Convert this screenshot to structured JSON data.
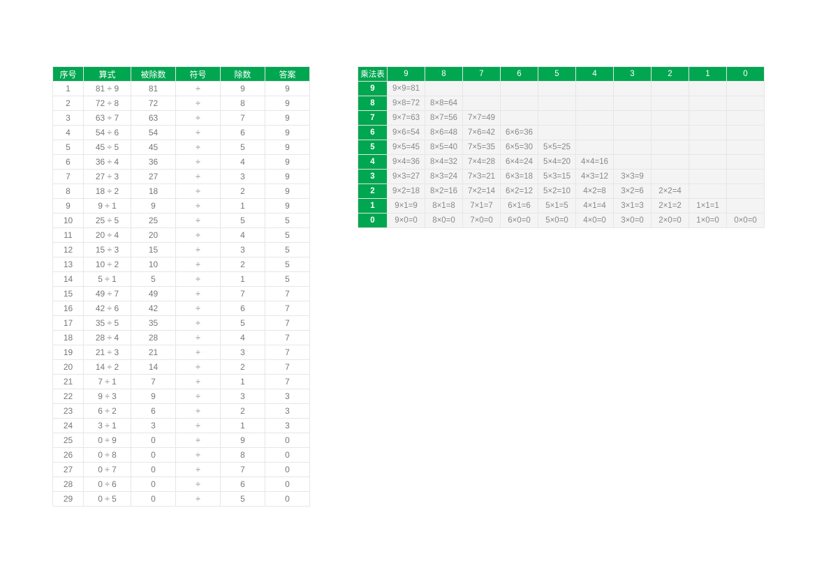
{
  "divTable": {
    "headers": [
      "序号",
      "算式",
      "被除数",
      "符号",
      "除数",
      "答案"
    ],
    "rows": [
      {
        "idx": "1",
        "expr": "81 ÷ 9",
        "dividend": "81",
        "sym": "÷",
        "divisor": "9",
        "ans": "9"
      },
      {
        "idx": "2",
        "expr": "72 ÷ 8",
        "dividend": "72",
        "sym": "÷",
        "divisor": "8",
        "ans": "9"
      },
      {
        "idx": "3",
        "expr": "63 ÷ 7",
        "dividend": "63",
        "sym": "÷",
        "divisor": "7",
        "ans": "9"
      },
      {
        "idx": "4",
        "expr": "54 ÷ 6",
        "dividend": "54",
        "sym": "÷",
        "divisor": "6",
        "ans": "9"
      },
      {
        "idx": "5",
        "expr": "45 ÷ 5",
        "dividend": "45",
        "sym": "÷",
        "divisor": "5",
        "ans": "9"
      },
      {
        "idx": "6",
        "expr": "36 ÷ 4",
        "dividend": "36",
        "sym": "÷",
        "divisor": "4",
        "ans": "9"
      },
      {
        "idx": "7",
        "expr": "27 ÷ 3",
        "dividend": "27",
        "sym": "÷",
        "divisor": "3",
        "ans": "9"
      },
      {
        "idx": "8",
        "expr": "18 ÷ 2",
        "dividend": "18",
        "sym": "÷",
        "divisor": "2",
        "ans": "9"
      },
      {
        "idx": "9",
        "expr": "9 ÷ 1",
        "dividend": "9",
        "sym": "÷",
        "divisor": "1",
        "ans": "9"
      },
      {
        "idx": "10",
        "expr": "25 ÷ 5",
        "dividend": "25",
        "sym": "÷",
        "divisor": "5",
        "ans": "5"
      },
      {
        "idx": "11",
        "expr": "20 ÷ 4",
        "dividend": "20",
        "sym": "÷",
        "divisor": "4",
        "ans": "5"
      },
      {
        "idx": "12",
        "expr": "15 ÷ 3",
        "dividend": "15",
        "sym": "÷",
        "divisor": "3",
        "ans": "5"
      },
      {
        "idx": "13",
        "expr": "10 ÷ 2",
        "dividend": "10",
        "sym": "÷",
        "divisor": "2",
        "ans": "5"
      },
      {
        "idx": "14",
        "expr": "5 ÷ 1",
        "dividend": "5",
        "sym": "÷",
        "divisor": "1",
        "ans": "5"
      },
      {
        "idx": "15",
        "expr": "49 ÷ 7",
        "dividend": "49",
        "sym": "÷",
        "divisor": "7",
        "ans": "7"
      },
      {
        "idx": "16",
        "expr": "42 ÷ 6",
        "dividend": "42",
        "sym": "÷",
        "divisor": "6",
        "ans": "7"
      },
      {
        "idx": "17",
        "expr": "35 ÷ 5",
        "dividend": "35",
        "sym": "÷",
        "divisor": "5",
        "ans": "7"
      },
      {
        "idx": "18",
        "expr": "28 ÷ 4",
        "dividend": "28",
        "sym": "÷",
        "divisor": "4",
        "ans": "7"
      },
      {
        "idx": "19",
        "expr": "21 ÷ 3",
        "dividend": "21",
        "sym": "÷",
        "divisor": "3",
        "ans": "7"
      },
      {
        "idx": "20",
        "expr": "14 ÷ 2",
        "dividend": "14",
        "sym": "÷",
        "divisor": "2",
        "ans": "7"
      },
      {
        "idx": "21",
        "expr": "7 ÷ 1",
        "dividend": "7",
        "sym": "÷",
        "divisor": "1",
        "ans": "7"
      },
      {
        "idx": "22",
        "expr": "9 ÷ 3",
        "dividend": "9",
        "sym": "÷",
        "divisor": "3",
        "ans": "3"
      },
      {
        "idx": "23",
        "expr": "6 ÷ 2",
        "dividend": "6",
        "sym": "÷",
        "divisor": "2",
        "ans": "3"
      },
      {
        "idx": "24",
        "expr": "3 ÷ 1",
        "dividend": "3",
        "sym": "÷",
        "divisor": "1",
        "ans": "3"
      },
      {
        "idx": "25",
        "expr": "0 ÷ 9",
        "dividend": "0",
        "sym": "÷",
        "divisor": "9",
        "ans": "0"
      },
      {
        "idx": "26",
        "expr": "0 ÷ 8",
        "dividend": "0",
        "sym": "÷",
        "divisor": "8",
        "ans": "0"
      },
      {
        "idx": "27",
        "expr": "0 ÷ 7",
        "dividend": "0",
        "sym": "÷",
        "divisor": "7",
        "ans": "0"
      },
      {
        "idx": "28",
        "expr": "0 ÷ 6",
        "dividend": "0",
        "sym": "÷",
        "divisor": "6",
        "ans": "0"
      },
      {
        "idx": "29",
        "expr": "0 ÷ 5",
        "dividend": "0",
        "sym": "÷",
        "divisor": "5",
        "ans": "0"
      }
    ]
  },
  "multTable": {
    "corner": "乘法表",
    "colHeaders": [
      "9",
      "8",
      "7",
      "6",
      "5",
      "4",
      "3",
      "2",
      "1",
      "0"
    ],
    "rows": [
      {
        "hdr": "9",
        "cells": [
          "9×9=81",
          "",
          "",
          "",
          "",
          "",
          "",
          "",
          "",
          ""
        ]
      },
      {
        "hdr": "8",
        "cells": [
          "9×8=72",
          "8×8=64",
          "",
          "",
          "",
          "",
          "",
          "",
          "",
          ""
        ]
      },
      {
        "hdr": "7",
        "cells": [
          "9×7=63",
          "8×7=56",
          "7×7=49",
          "",
          "",
          "",
          "",
          "",
          "",
          ""
        ]
      },
      {
        "hdr": "6",
        "cells": [
          "9×6=54",
          "8×6=48",
          "7×6=42",
          "6×6=36",
          "",
          "",
          "",
          "",
          "",
          ""
        ]
      },
      {
        "hdr": "5",
        "cells": [
          "9×5=45",
          "8×5=40",
          "7×5=35",
          "6×5=30",
          "5×5=25",
          "",
          "",
          "",
          "",
          ""
        ]
      },
      {
        "hdr": "4",
        "cells": [
          "9×4=36",
          "8×4=32",
          "7×4=28",
          "6×4=24",
          "5×4=20",
          "4×4=16",
          "",
          "",
          "",
          ""
        ]
      },
      {
        "hdr": "3",
        "cells": [
          "9×3=27",
          "8×3=24",
          "7×3=21",
          "6×3=18",
          "5×3=15",
          "4×3=12",
          "3×3=9",
          "",
          "",
          ""
        ]
      },
      {
        "hdr": "2",
        "cells": [
          "9×2=18",
          "8×2=16",
          "7×2=14",
          "6×2=12",
          "5×2=10",
          "4×2=8",
          "3×2=6",
          "2×2=4",
          "",
          ""
        ]
      },
      {
        "hdr": "1",
        "cells": [
          "9×1=9",
          "8×1=8",
          "7×1=7",
          "6×1=6",
          "5×1=5",
          "4×1=4",
          "3×1=3",
          "2×1=2",
          "1×1=1",
          ""
        ]
      },
      {
        "hdr": "0",
        "cells": [
          "9×0=0",
          "8×0=0",
          "7×0=0",
          "6×0=0",
          "5×0=0",
          "4×0=0",
          "3×0=0",
          "2×0=0",
          "1×0=0",
          "0×0=0"
        ]
      }
    ]
  }
}
